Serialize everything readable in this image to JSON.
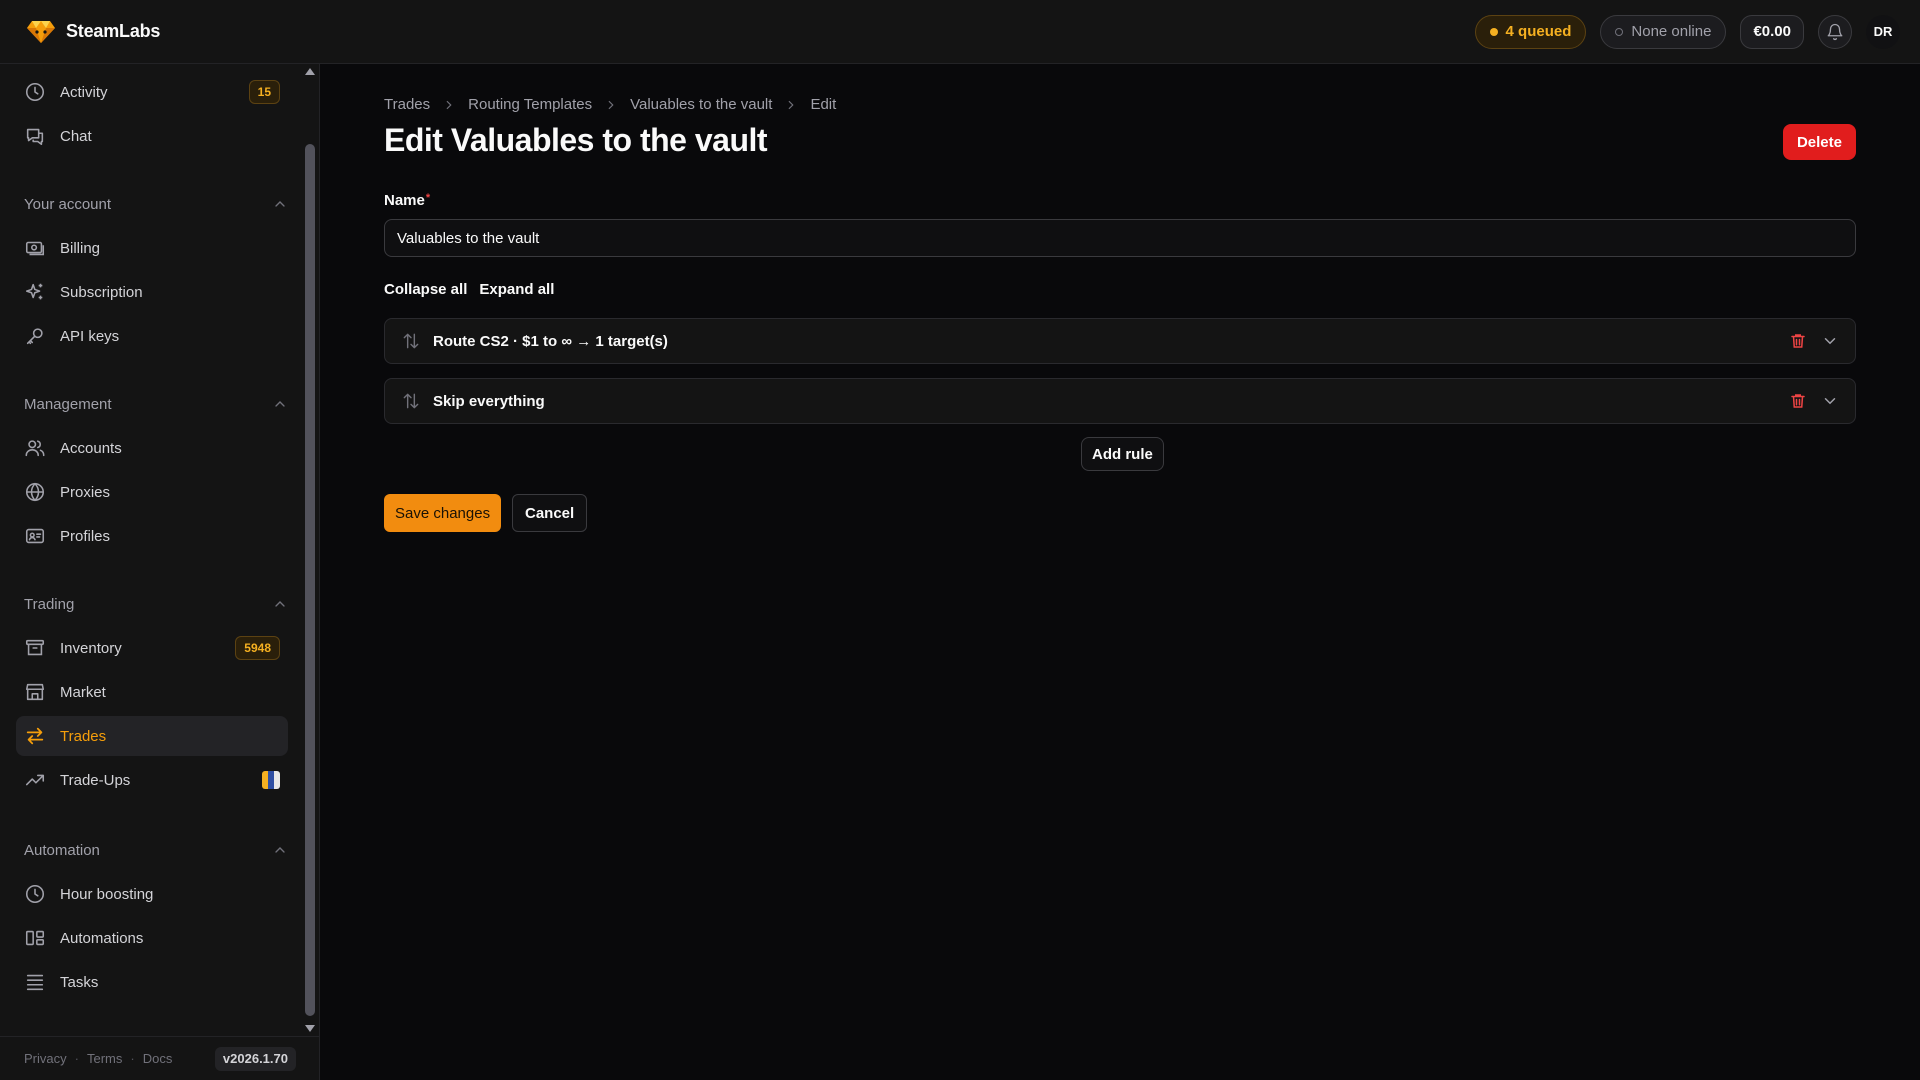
{
  "app": {
    "brand": "SteamLabs"
  },
  "topbar": {
    "queued": "4 queued",
    "online": "None online",
    "balance": "€0.00",
    "avatar": "DR",
    "notification_icon": "bell-icon"
  },
  "sidebar": {
    "items": {
      "activity": {
        "label": "Activity",
        "badge": "15",
        "icon": "clock-icon"
      },
      "chat": {
        "label": "Chat",
        "icon": "chat-icon"
      },
      "billing": {
        "label": "Billing",
        "icon": "billing-icon"
      },
      "subscription": {
        "label": "Subscription",
        "icon": "sparkles-icon"
      },
      "api_keys": {
        "label": "API keys",
        "icon": "key-icon"
      },
      "accounts": {
        "label": "Accounts",
        "icon": "users-icon"
      },
      "proxies": {
        "label": "Proxies",
        "icon": "globe-icon"
      },
      "profiles": {
        "label": "Profiles",
        "icon": "id-card-icon"
      },
      "inventory": {
        "label": "Inventory",
        "badge": "5948",
        "icon": "archive-icon"
      },
      "market": {
        "label": "Market",
        "icon": "store-icon"
      },
      "trades": {
        "label": "Trades",
        "icon": "swap-icon",
        "active": true
      },
      "trade_ups": {
        "label": "Trade-Ups",
        "icon": "trending-up-icon"
      },
      "hour_boosting": {
        "label": "Hour boosting",
        "icon": "clock-icon"
      },
      "automations": {
        "label": "Automations",
        "icon": "automation-icon"
      },
      "tasks": {
        "label": "Tasks",
        "icon": "list-icon"
      }
    },
    "sections": {
      "account": "Your account",
      "management": "Management",
      "trading": "Trading",
      "automation": "Automation"
    },
    "footer": {
      "privacy": "Privacy",
      "terms": "Terms",
      "docs": "Docs",
      "separator": "·",
      "version": "v2026.1.70"
    }
  },
  "breadcrumb": [
    "Trades",
    "Routing Templates",
    "Valuables to the vault",
    "Edit"
  ],
  "page": {
    "title": "Edit Valuables to the vault",
    "delete_label": "Delete",
    "name_label": "Name",
    "name_required": "*",
    "name_value": "Valuables to the vault",
    "collapse_all": "Collapse all",
    "expand_all": "Expand all",
    "rules": [
      {
        "title": "Route CS2 · $1 to ∞ → 1 target(s)"
      },
      {
        "title": "Skip everything"
      }
    ],
    "add_rule": "Add rule",
    "save": "Save changes",
    "cancel": "Cancel"
  },
  "colors": {
    "accent": "#f59e0b",
    "danger": "#e11d1d",
    "background": "#09090b",
    "panel": "#141414"
  }
}
